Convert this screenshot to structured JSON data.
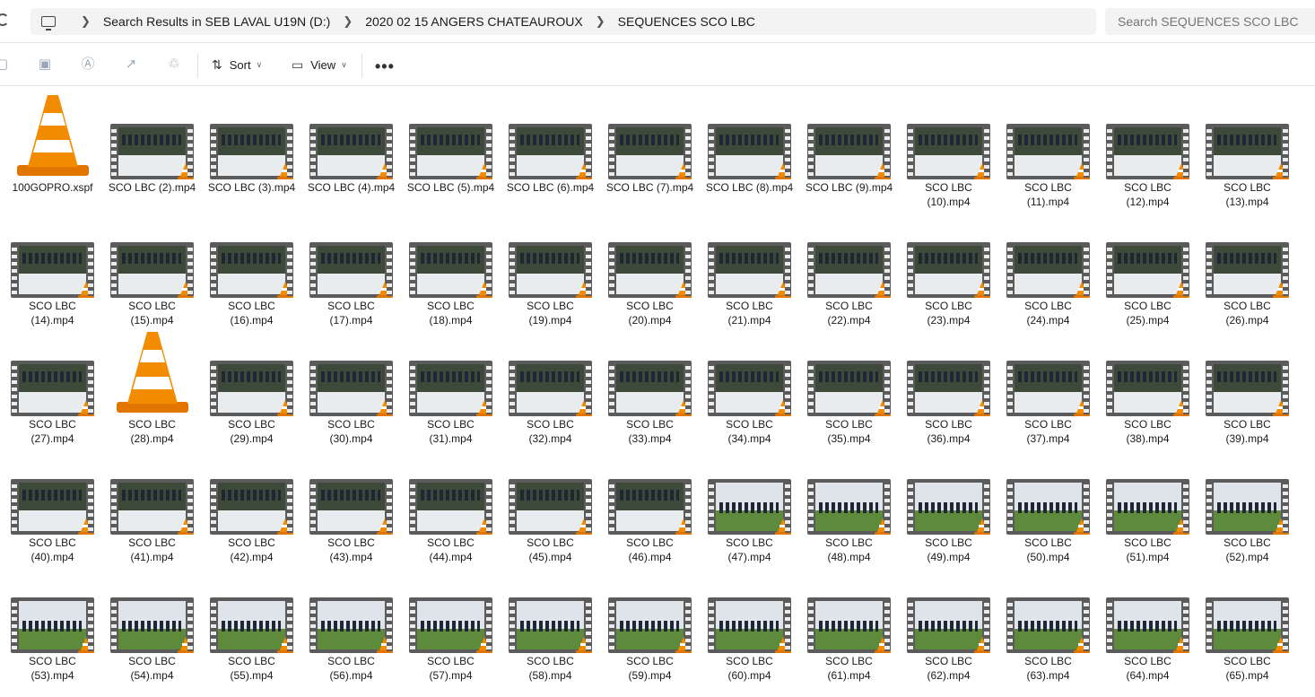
{
  "address_bar": {
    "crumbs": [
      "Search Results in SEB LAVAL U19N (D:)",
      "2020 02 15 ANGERS CHATEAUROUX",
      "SEQUENCES SCO LBC"
    ],
    "search_placeholder": "Search SEQUENCES SCO LBC"
  },
  "toolbar": {
    "sort_label": "Sort",
    "view_label": "View",
    "more_label": "•••"
  },
  "files": [
    {
      "line1": "100GOPRO.xspf",
      "line2": "",
      "kind": "vlc"
    },
    {
      "line1": "SCO LBC (2).mp4",
      "line2": "",
      "kind": "video",
      "scene": "a"
    },
    {
      "line1": "SCO LBC (3).mp4",
      "line2": "",
      "kind": "video",
      "scene": "a"
    },
    {
      "line1": "SCO LBC (4).mp4",
      "line2": "",
      "kind": "video",
      "scene": "a"
    },
    {
      "line1": "SCO LBC (5).mp4",
      "line2": "",
      "kind": "video",
      "scene": "a"
    },
    {
      "line1": "SCO LBC (6).mp4",
      "line2": "",
      "kind": "video",
      "scene": "a"
    },
    {
      "line1": "SCO LBC (7).mp4",
      "line2": "",
      "kind": "video",
      "scene": "a"
    },
    {
      "line1": "SCO LBC (8).mp4",
      "line2": "",
      "kind": "video",
      "scene": "a"
    },
    {
      "line1": "SCO LBC (9).mp4",
      "line2": "",
      "kind": "video",
      "scene": "a"
    },
    {
      "line1": "SCO LBC",
      "line2": "(10).mp4",
      "kind": "video",
      "scene": "a"
    },
    {
      "line1": "SCO LBC",
      "line2": "(11).mp4",
      "kind": "video",
      "scene": "a"
    },
    {
      "line1": "SCO LBC",
      "line2": "(12).mp4",
      "kind": "video",
      "scene": "a"
    },
    {
      "line1": "SCO LBC",
      "line2": "(13).mp4",
      "kind": "video",
      "scene": "a"
    },
    {
      "line1": "SCO LBC",
      "line2": "(14).mp4",
      "kind": "video",
      "scene": "a"
    },
    {
      "line1": "SCO LBC",
      "line2": "(15).mp4",
      "kind": "video",
      "scene": "a"
    },
    {
      "line1": "SCO LBC",
      "line2": "(16).mp4",
      "kind": "video",
      "scene": "a"
    },
    {
      "line1": "SCO LBC",
      "line2": "(17).mp4",
      "kind": "video",
      "scene": "a"
    },
    {
      "line1": "SCO LBC",
      "line2": "(18).mp4",
      "kind": "video",
      "scene": "a"
    },
    {
      "line1": "SCO LBC",
      "line2": "(19).mp4",
      "kind": "video",
      "scene": "a"
    },
    {
      "line1": "SCO LBC",
      "line2": "(20).mp4",
      "kind": "video",
      "scene": "a"
    },
    {
      "line1": "SCO LBC",
      "line2": "(21).mp4",
      "kind": "video",
      "scene": "a"
    },
    {
      "line1": "SCO LBC",
      "line2": "(22).mp4",
      "kind": "video",
      "scene": "a"
    },
    {
      "line1": "SCO LBC",
      "line2": "(23).mp4",
      "kind": "video",
      "scene": "a"
    },
    {
      "line1": "SCO LBC",
      "line2": "(24).mp4",
      "kind": "video",
      "scene": "a"
    },
    {
      "line1": "SCO LBC",
      "line2": "(25).mp4",
      "kind": "video",
      "scene": "a"
    },
    {
      "line1": "SCO LBC",
      "line2": "(26).mp4",
      "kind": "video",
      "scene": "a"
    },
    {
      "line1": "SCO LBC",
      "line2": "(27).mp4",
      "kind": "video",
      "scene": "a"
    },
    {
      "line1": "SCO LBC",
      "line2": "(28).mp4",
      "kind": "vlc"
    },
    {
      "line1": "SCO LBC",
      "line2": "(29).mp4",
      "kind": "video",
      "scene": "a"
    },
    {
      "line1": "SCO LBC",
      "line2": "(30).mp4",
      "kind": "video",
      "scene": "a"
    },
    {
      "line1": "SCO LBC",
      "line2": "(31).mp4",
      "kind": "video",
      "scene": "a"
    },
    {
      "line1": "SCO LBC",
      "line2": "(32).mp4",
      "kind": "video",
      "scene": "a"
    },
    {
      "line1": "SCO LBC",
      "line2": "(33).mp4",
      "kind": "video",
      "scene": "a"
    },
    {
      "line1": "SCO LBC",
      "line2": "(34).mp4",
      "kind": "video",
      "scene": "a"
    },
    {
      "line1": "SCO LBC",
      "line2": "(35).mp4",
      "kind": "video",
      "scene": "a"
    },
    {
      "line1": "SCO LBC",
      "line2": "(36).mp4",
      "kind": "video",
      "scene": "a"
    },
    {
      "line1": "SCO LBC",
      "line2": "(37).mp4",
      "kind": "video",
      "scene": "a"
    },
    {
      "line1": "SCO LBC",
      "line2": "(38).mp4",
      "kind": "video",
      "scene": "a"
    },
    {
      "line1": "SCO LBC",
      "line2": "(39).mp4",
      "kind": "video",
      "scene": "a"
    },
    {
      "line1": "SCO LBC",
      "line2": "(40).mp4",
      "kind": "video",
      "scene": "a"
    },
    {
      "line1": "SCO LBC",
      "line2": "(41).mp4",
      "kind": "video",
      "scene": "a"
    },
    {
      "line1": "SCO LBC",
      "line2": "(42).mp4",
      "kind": "video",
      "scene": "a"
    },
    {
      "line1": "SCO LBC",
      "line2": "(43).mp4",
      "kind": "video",
      "scene": "a"
    },
    {
      "line1": "SCO LBC",
      "line2": "(44).mp4",
      "kind": "video",
      "scene": "a"
    },
    {
      "line1": "SCO LBC",
      "line2": "(45).mp4",
      "kind": "video",
      "scene": "a"
    },
    {
      "line1": "SCO LBC",
      "line2": "(46).mp4",
      "kind": "video",
      "scene": "a"
    },
    {
      "line1": "SCO LBC",
      "line2": "(47).mp4",
      "kind": "video",
      "scene": "b"
    },
    {
      "line1": "SCO LBC",
      "line2": "(48).mp4",
      "kind": "video",
      "scene": "b"
    },
    {
      "line1": "SCO LBC",
      "line2": "(49).mp4",
      "kind": "video",
      "scene": "b"
    },
    {
      "line1": "SCO LBC",
      "line2": "(50).mp4",
      "kind": "video",
      "scene": "b"
    },
    {
      "line1": "SCO LBC",
      "line2": "(51).mp4",
      "kind": "video",
      "scene": "b"
    },
    {
      "line1": "SCO LBC",
      "line2": "(52).mp4",
      "kind": "video",
      "scene": "b"
    },
    {
      "line1": "SCO LBC",
      "line2": "(53).mp4",
      "kind": "video",
      "scene": "b"
    },
    {
      "line1": "SCO LBC",
      "line2": "(54).mp4",
      "kind": "video",
      "scene": "b"
    },
    {
      "line1": "SCO LBC",
      "line2": "(55).mp4",
      "kind": "video",
      "scene": "b"
    },
    {
      "line1": "SCO LBC",
      "line2": "(56).mp4",
      "kind": "video",
      "scene": "b"
    },
    {
      "line1": "SCO LBC",
      "line2": "(57).mp4",
      "kind": "video",
      "scene": "b"
    },
    {
      "line1": "SCO LBC",
      "line2": "(58).mp4",
      "kind": "video",
      "scene": "b"
    },
    {
      "line1": "SCO LBC",
      "line2": "(59).mp4",
      "kind": "video",
      "scene": "b"
    },
    {
      "line1": "SCO LBC",
      "line2": "(60).mp4",
      "kind": "video",
      "scene": "b"
    },
    {
      "line1": "SCO LBC",
      "line2": "(61).mp4",
      "kind": "video",
      "scene": "b"
    },
    {
      "line1": "SCO LBC",
      "line2": "(62).mp4",
      "kind": "video",
      "scene": "b"
    },
    {
      "line1": "SCO LBC",
      "line2": "(63).mp4",
      "kind": "video",
      "scene": "b"
    },
    {
      "line1": "SCO LBC",
      "line2": "(64).mp4",
      "kind": "video",
      "scene": "b"
    },
    {
      "line1": "SCO LBC",
      "line2": "(65).mp4",
      "kind": "video",
      "scene": "b"
    }
  ],
  "colors": {
    "vlc_orange": "#f28b00",
    "filmstrip": "#5b5b5b",
    "scene_a_top": "#3d4a3a",
    "scene_a_bottom": "#e8ecef",
    "scene_b_top": "#dfe4ea",
    "scene_b_bottom": "#5e8a3c"
  },
  "icons": {
    "refresh": "refresh-icon",
    "this_pc": "computer-icon",
    "copy": "copy-icon",
    "paste": "paste-icon",
    "rename": "rename-icon",
    "share": "share-icon",
    "delete": "trash-icon",
    "sort": "sort-icon",
    "view": "view-icon",
    "more": "more-icon"
  }
}
